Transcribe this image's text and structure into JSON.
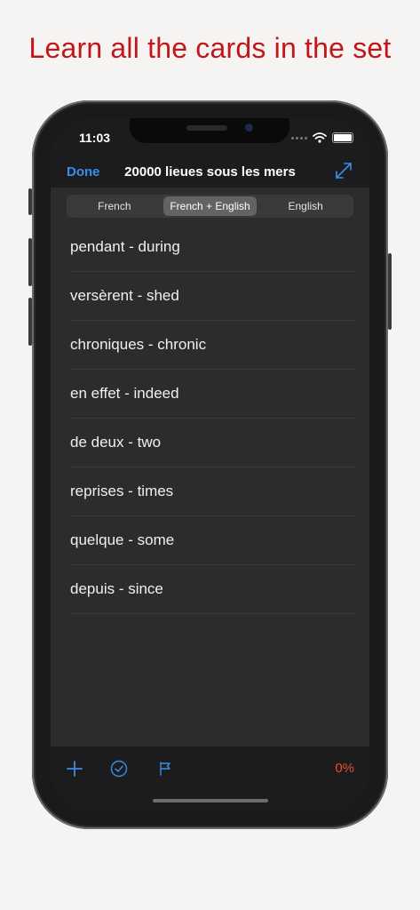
{
  "headline": "Learn all the cards in the set",
  "status": {
    "time": "11:03"
  },
  "nav": {
    "done_label": "Done",
    "title": "20000 lieues sous les mers"
  },
  "segments": [
    "French",
    "French + English",
    "English"
  ],
  "selected_segment": "French + English",
  "cards": [
    "pendant - during",
    "versèrent - shed",
    "chroniques - chronic",
    "en effet - indeed",
    "de deux - two",
    "reprises - times",
    "quelque - some",
    "depuis - since"
  ],
  "toolbar": {
    "progress": "0%"
  },
  "colors": {
    "accent": "#3a8ee6",
    "headline": "#c0171a",
    "progress": "#e8502a"
  }
}
